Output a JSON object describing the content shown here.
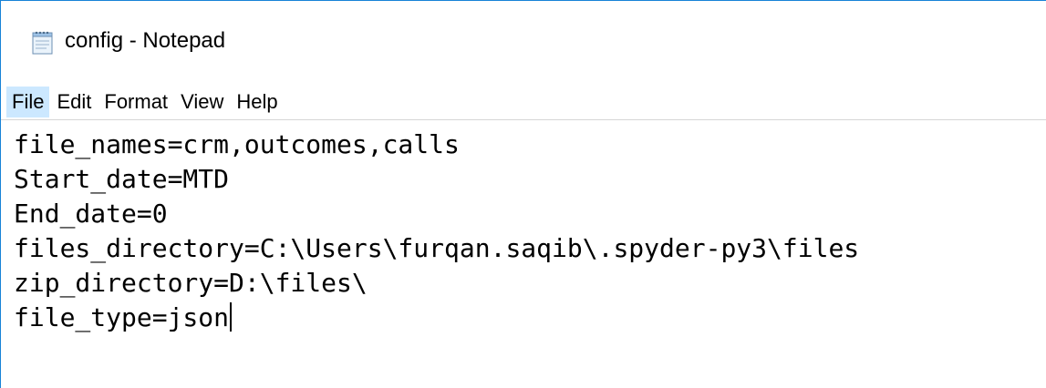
{
  "window": {
    "title": "config - Notepad",
    "icon": "notepad-icon"
  },
  "menu": {
    "items": [
      {
        "label": "File",
        "active": true
      },
      {
        "label": "Edit",
        "active": false
      },
      {
        "label": "Format",
        "active": false
      },
      {
        "label": "View",
        "active": false
      },
      {
        "label": "Help",
        "active": false
      }
    ]
  },
  "editor": {
    "lines": [
      "file_names=crm,outcomes,calls",
      "Start_date=MTD",
      "End_date=0",
      "files_directory=C:\\Users\\furqan.saqib\\.spyder-py3\\files",
      "zip_directory=D:\\files\\",
      "file_type=json"
    ]
  },
  "colors": {
    "window_border": "#1883d7",
    "menu_active": "#cce8ff"
  }
}
